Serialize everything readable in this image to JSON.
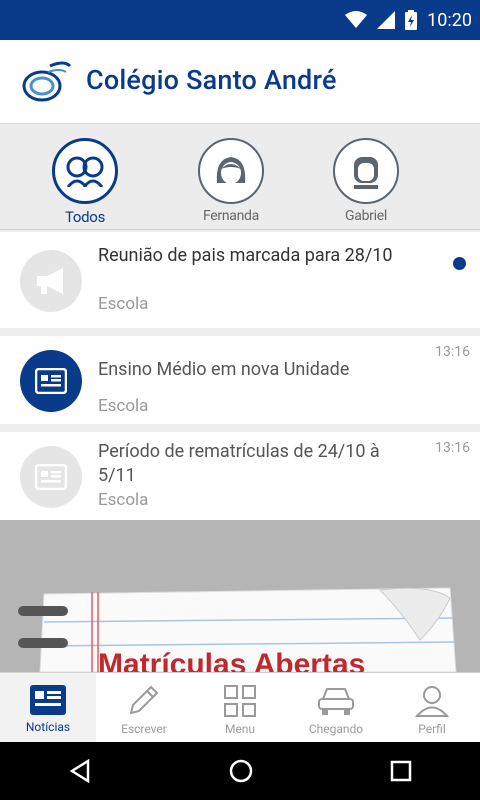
{
  "status_bar": {
    "time": "10:20",
    "bg_color": "#0a3a8a"
  },
  "header": {
    "title": "Colégio Santo André",
    "logo_icon": "school-logo-icon"
  },
  "filters": [
    {
      "label": "Todos",
      "icon": "group-icon",
      "active": true
    },
    {
      "label": "Fernanda",
      "icon": "girl-avatar-icon",
      "active": false
    },
    {
      "label": "Gabriel",
      "icon": "boy-avatar-icon",
      "active": false
    }
  ],
  "messages": [
    {
      "title": "Reunião de pais marcada para 28/10",
      "source": "Escola",
      "time": "",
      "unread": true,
      "icon": "megaphone-icon"
    },
    {
      "title": "Ensino Médio em nova Unidade",
      "source": "Escola",
      "time": "13:16",
      "unread": false,
      "icon": "news-icon"
    },
    {
      "title": "Período de rematrículas de 24/10 à 5/11",
      "source": "Escola",
      "time": "13:16",
      "unread": false,
      "icon": "news-icon"
    }
  ],
  "banner": {
    "text": "Matrículas Abertas"
  },
  "bottom_nav": [
    {
      "label": "Notícias",
      "icon": "news-icon",
      "active": true
    },
    {
      "label": "Escrever",
      "icon": "pencil-icon",
      "active": false
    },
    {
      "label": "Menu",
      "icon": "grid-icon",
      "active": false
    },
    {
      "label": "Chegando",
      "icon": "car-icon",
      "active": false
    },
    {
      "label": "Perfil",
      "icon": "person-icon",
      "active": false
    }
  ],
  "colors": {
    "accent": "#0a3a8a",
    "muted": "#999999"
  }
}
